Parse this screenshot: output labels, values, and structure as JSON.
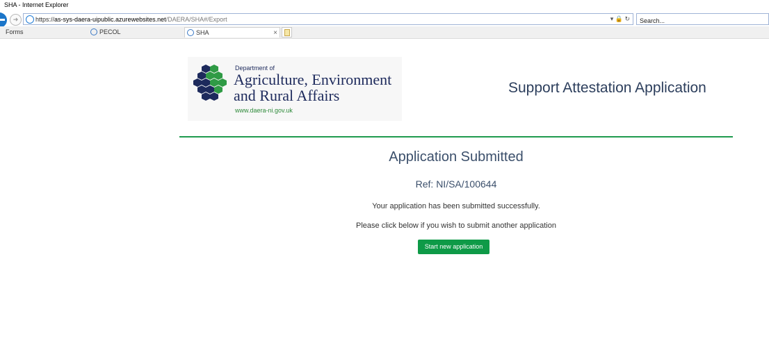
{
  "window": {
    "title": "SHA - Internet Explorer"
  },
  "addressbar": {
    "url_prefix": "https://",
    "url_domain": "as-sys-daera-uipublic.azurewebsites.net",
    "url_path": "/DAERA/SHA#/Export",
    "icons": "▾ 🔒 ↻"
  },
  "search": {
    "placeholder": "Search..."
  },
  "tabs": [
    {
      "label": "Forms"
    },
    {
      "label": "PECOL"
    },
    {
      "label": "SHA",
      "active": true
    }
  ],
  "tab_close": "×",
  "logo": {
    "small": "Department of",
    "line1": "Agriculture, Environment",
    "line2": "and Rural Affairs",
    "url": "www.daera-ni.gov.uk"
  },
  "header": {
    "app_title": "Support Attestation Application"
  },
  "main": {
    "heading": "Application Submitted",
    "reference": "Ref: NI/SA/100644",
    "message": "Your application has been submitted successfully.",
    "instruction": "Please click below if you wish to submit another application",
    "button_label": "Start new application"
  },
  "colors": {
    "accent_green": "#0e9a47",
    "divider_green": "#1e9a4e",
    "heading_text": "#3b4f6b",
    "logo_navy": "#1d2a5c"
  }
}
